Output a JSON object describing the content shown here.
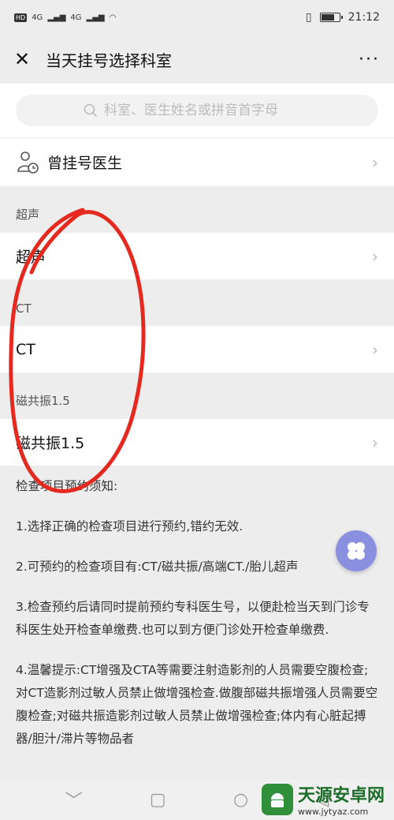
{
  "status_bar": {
    "left_label": "HD",
    "time": "21:12",
    "signal1": "4G",
    "signal2": "4G"
  },
  "header": {
    "title": "当天挂号选择科室",
    "close_icon": "close-icon",
    "more_label": "···"
  },
  "search": {
    "placeholder": "科室、医生姓名或拼音首字母"
  },
  "history": {
    "label": "曾挂号医生"
  },
  "sections": [
    {
      "title": "超声",
      "item": "超声"
    },
    {
      "title": "CT",
      "item": "CT"
    },
    {
      "title": "磁共振1.5",
      "item": "磁共振1.5"
    }
  ],
  "notice": {
    "heading": "检查项目预约须知:",
    "p1": "1.选择正确的检查项目进行预约,错约无效.",
    "p2": "2.可预约的检查项目有:CT/磁共振/高端CT./胎儿超声",
    "p3": "3.检查预约后请同时提前预约专科医生号，以便赴检当天到门诊专科医生处开检查单缴费.也可以到方便门诊处开检查单缴费.",
    "p4": "4.温馨提示:CT增强及CTA等需要注射造影剂的人员需要空腹检查;对CT造影剂过敏人员禁止做增强检查.做腹部磁共振增强人员需要空腹检查;对磁共振造影剂过敏人员禁止做增强检查;体内有心脏起搏器/胆汁/滞片等物品者"
  },
  "watermark": {
    "name": "天源安卓网",
    "url": "www.jytyaz.com"
  },
  "colors": {
    "annotation": "#e5291f",
    "float": "#8b8fe0"
  }
}
